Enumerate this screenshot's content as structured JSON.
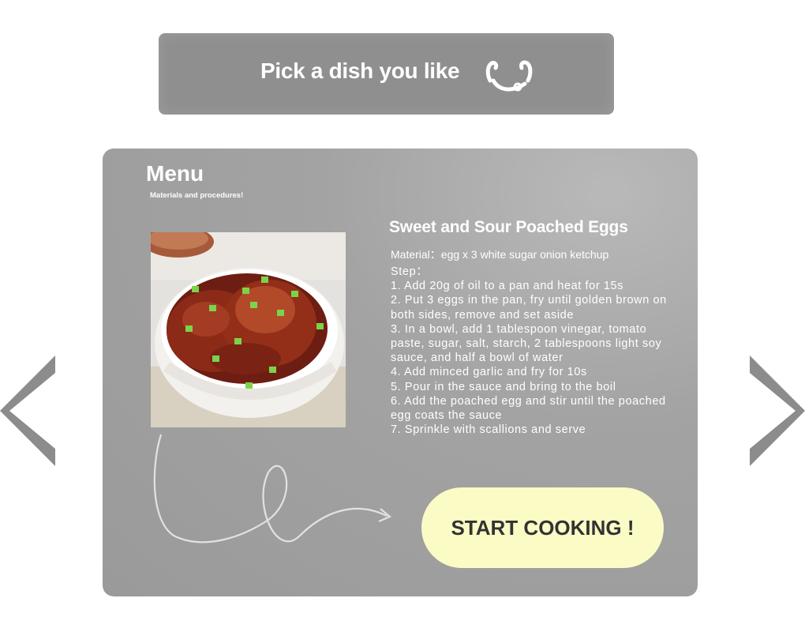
{
  "banner": {
    "text": "Pick a dish you like",
    "icon": "smile-icon"
  },
  "menu": {
    "title": "Menu",
    "subtitle": "Materials and procedures!"
  },
  "dish": {
    "name": "Sweet and Sour Poached Eggs",
    "materials": "Material：egg x 3  white sugar  onion ketchup",
    "step_header": "Step：",
    "steps": [
      "1. Add 20g of oil to a pan and heat for 15s",
      "2. Put 3 eggs in the pan, fry until golden brown on both sides, remove and set aside",
      "3. In a bowl, add 1 tablespoon vinegar, tomato paste, sugar, salt, starch, 2 tablespoons light soy sauce, and half a bowl of water",
      "4. Add minced garlic and fry for 10s",
      "5. Pour in the sauce and bring to the boil",
      "6. Add the poached egg and stir until the poached egg coats the sauce",
      "7. Sprinkle with scallions and serve"
    ]
  },
  "actions": {
    "start_label": "START COOKING !"
  },
  "nav": {
    "prev_icon": "chevron-left-icon",
    "next_icon": "chevron-right-icon"
  },
  "colors": {
    "panel": "#9a9a9a",
    "button": "#fbfbc6",
    "text": "#ffffff"
  }
}
